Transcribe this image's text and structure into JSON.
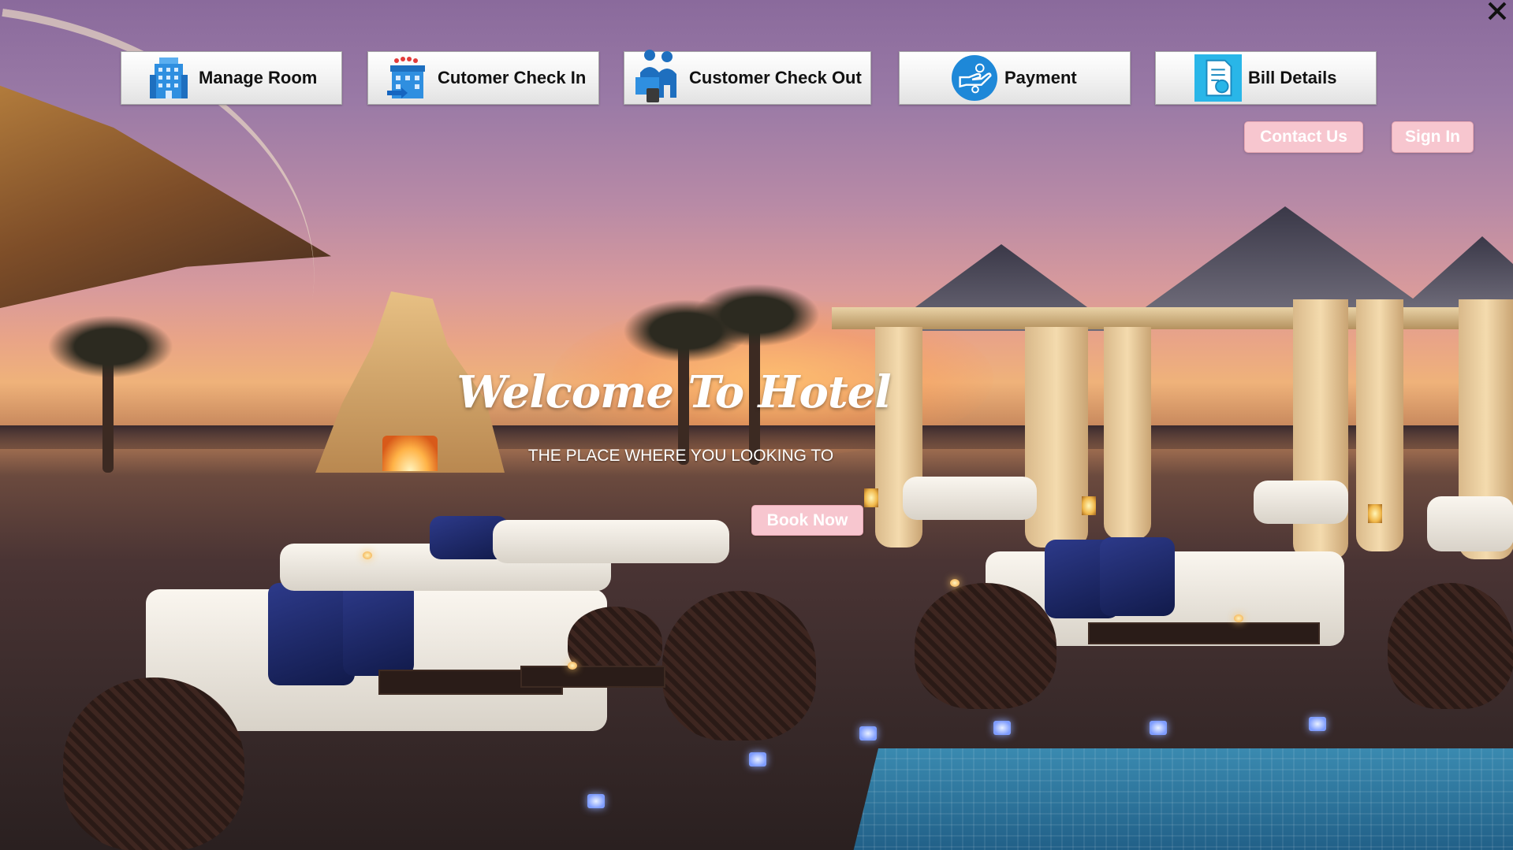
{
  "window": {
    "close_icon": "close-icon"
  },
  "nav": {
    "items": [
      {
        "label": "Manage Room",
        "icon": "hotel-building-icon"
      },
      {
        "label": "Cutomer Check In",
        "icon": "hotel-check-in-icon"
      },
      {
        "label": "Customer Check Out",
        "icon": "reception-desk-icon"
      },
      {
        "label": "Payment",
        "icon": "payment-hand-icon"
      },
      {
        "label": "Bill Details",
        "icon": "bill-document-icon"
      }
    ]
  },
  "header_actions": {
    "contact_label": "Contact Us",
    "signin_label": "Sign In"
  },
  "hero": {
    "title": "Welcome To Hotel",
    "subtitle": "THE PLACE WHERE YOU LOOKING TO",
    "cta_label": "Book Now"
  },
  "colors": {
    "accent_pink": "#f7c6cf",
    "button_text": "#111111",
    "icon_blue": "#1e88d8"
  }
}
